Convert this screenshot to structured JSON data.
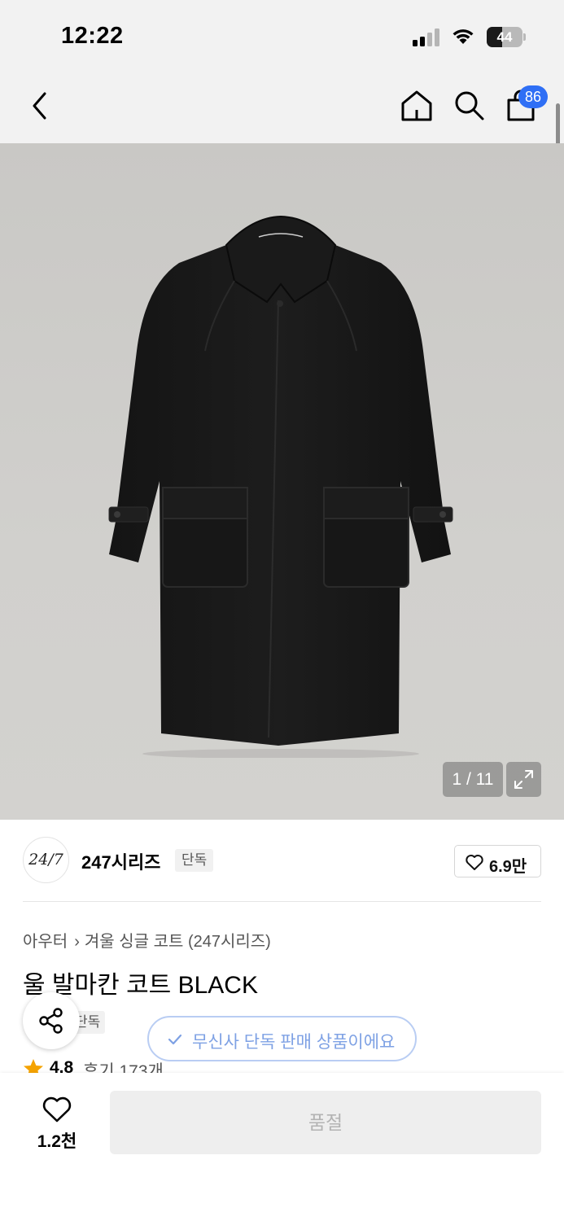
{
  "status_bar": {
    "time": "12:22",
    "battery": "44",
    "battery_level": 0.44
  },
  "nav": {
    "cart_count": "86"
  },
  "gallery": {
    "counter": "1 / 11",
    "current": 1,
    "total": 11
  },
  "brand": {
    "logo_text": "24/7",
    "name": "247시리즈",
    "tag": "단독",
    "like_count": "6.9만"
  },
  "product": {
    "breadcrumb": [
      "아우터",
      "겨울 싱글 코트 (247시리즈)"
    ],
    "title": "울 발마칸 코트 BLACK",
    "exclusive_tag": "단독",
    "rating": "4.8",
    "reviews": "후기 173개"
  },
  "toast": {
    "message": "무신사 단독 판매 상품이에요"
  },
  "bottom_bar": {
    "wish_count": "1.2천",
    "soldout_label": "품절"
  },
  "colors": {
    "accent_blue": "#2f6ff5",
    "toast_text": "#7ea1e4",
    "star": "#f5a300"
  }
}
